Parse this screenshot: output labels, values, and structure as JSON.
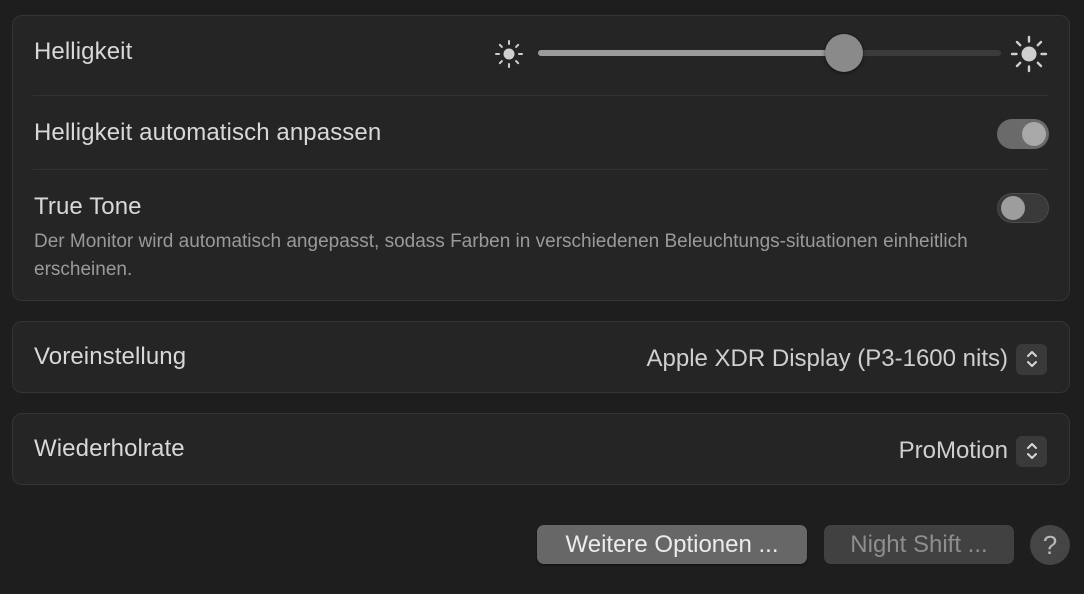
{
  "display": {
    "brightness": {
      "label": "Helligkeit",
      "value": 0.66,
      "min_icon": "sun-small-icon",
      "max_icon": "sun-large-icon"
    },
    "auto_brightness": {
      "label": "Helligkeit automatisch anpassen",
      "enabled": true
    },
    "true_tone": {
      "label": "True Tone",
      "enabled": false,
      "description": "Der Monitor wird automatisch angepasst, sodass Farben in verschiedenen Beleuchtungs-situationen einheitlich erscheinen."
    }
  },
  "preset": {
    "label": "Voreinstellung",
    "value": "Apple XDR Display (P3-1600 nits)",
    "icon": "chevron-updown-icon"
  },
  "refresh_rate": {
    "label": "Wiederholrate",
    "value": "ProMotion",
    "icon": "chevron-updown-icon"
  },
  "buttons": {
    "more_options": "Weitere Optionen ...",
    "night_shift": "Night Shift ...",
    "help": "?"
  },
  "colors": {
    "background": "#1e1e1e",
    "panel": "#252525",
    "toggle_on": "#6a6a6a"
  }
}
